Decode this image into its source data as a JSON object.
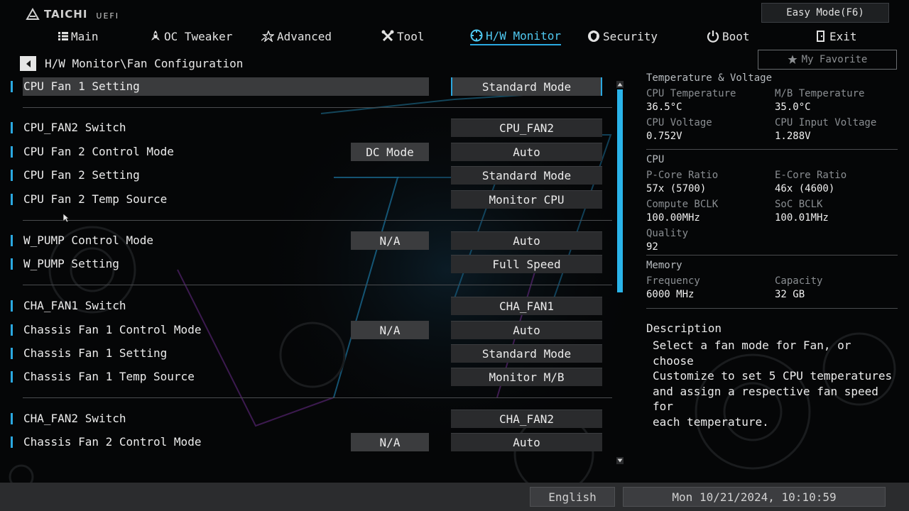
{
  "brand": {
    "name": "TAICHI",
    "sub": "UEFI"
  },
  "easy_mode_label": "Easy Mode(F6)",
  "nav": [
    {
      "label": "Main",
      "icon": "list-icon"
    },
    {
      "label": "OC Tweaker",
      "icon": "rocket-icon"
    },
    {
      "label": "Advanced",
      "icon": "star-icon"
    },
    {
      "label": "Tool",
      "icon": "tools-icon"
    },
    {
      "label": "H/W Monitor",
      "icon": "monitor-icon",
      "active": true
    },
    {
      "label": "Security",
      "icon": "shield-icon"
    },
    {
      "label": "Boot",
      "icon": "power-icon"
    },
    {
      "label": "Exit",
      "icon": "exit-icon"
    }
  ],
  "favorite_label": "My Favorite",
  "breadcrumb": "H/W Monitor\\Fan Configuration",
  "settings": {
    "r0": {
      "label": "CPU Fan 1 Setting",
      "value": "Standard Mode"
    },
    "r1": {
      "label": "CPU_FAN2 Switch",
      "value": "CPU_FAN2"
    },
    "r2": {
      "label": "CPU Fan 2 Control Mode",
      "mid": "DC Mode",
      "value": "Auto"
    },
    "r3": {
      "label": "CPU Fan 2 Setting",
      "value": "Standard Mode"
    },
    "r4": {
      "label": "CPU Fan 2 Temp Source",
      "value": "Monitor CPU"
    },
    "r5": {
      "label": "W_PUMP Control Mode",
      "mid": "N/A",
      "value": "Auto"
    },
    "r6": {
      "label": "W_PUMP Setting",
      "value": "Full Speed"
    },
    "r7": {
      "label": "CHA_FAN1 Switch",
      "value": "CHA_FAN1"
    },
    "r8": {
      "label": "Chassis Fan 1 Control Mode",
      "mid": "N/A",
      "value": "Auto"
    },
    "r9": {
      "label": "Chassis Fan 1 Setting",
      "value": "Standard Mode"
    },
    "r10": {
      "label": "Chassis Fan 1 Temp Source",
      "value": "Monitor M/B"
    },
    "r11": {
      "label": "CHA_FAN2 Switch",
      "value": "CHA_FAN2"
    },
    "r12": {
      "label": "Chassis Fan 2 Control Mode",
      "mid": "N/A",
      "value": "Auto"
    }
  },
  "panel": {
    "temp_title": "Temperature & Voltage",
    "cpu_temp_label": "CPU Temperature",
    "cpu_temp": "36.5°C",
    "mb_temp_label": "M/B Temperature",
    "mb_temp": "35.0°C",
    "cpu_volt_label": "CPU Voltage",
    "cpu_volt": "0.752V",
    "cpu_in_volt_label": "CPU Input Voltage",
    "cpu_in_volt": "1.288V",
    "cpu_title": "CPU",
    "pcore_label": "P-Core Ratio",
    "pcore": "57x (5700)",
    "ecore_label": "E-Core Ratio",
    "ecore": "46x (4600)",
    "bclk_label": "Compute BCLK",
    "bclk": "100.00MHz",
    "soc_label": "SoC BCLK",
    "soc": "100.01MHz",
    "quality_label": "Quality",
    "quality": "92",
    "mem_title": "Memory",
    "freq_label": "Frequency",
    "freq": "6000 MHz",
    "cap_label": "Capacity",
    "cap": "32 GB"
  },
  "description": {
    "title": "Description",
    "lines": [
      "Select a fan mode for Fan, or choose",
      "Customize to set 5 CPU temperatures",
      "and assign a respective fan speed for",
      "each temperature."
    ]
  },
  "footer": {
    "language": "English",
    "datetime": "Mon 10/21/2024, 10:10:59"
  },
  "colors": {
    "accent": "#2aa8e0",
    "active_text": "#4fc8f0",
    "background": "#050607"
  }
}
